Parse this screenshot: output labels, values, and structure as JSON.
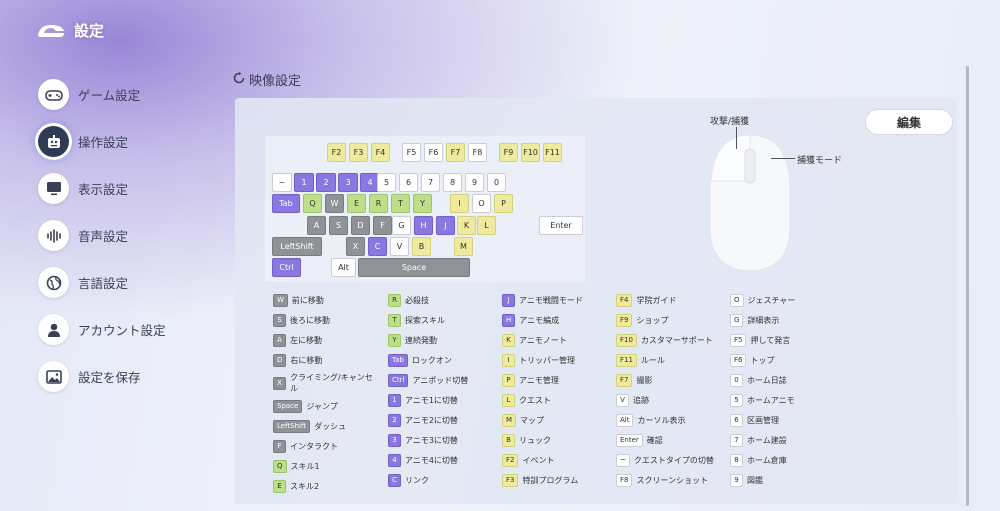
{
  "app": {
    "title": "設定"
  },
  "nav": [
    {
      "label": "ゲーム設定",
      "icon": "gamepad-icon"
    },
    {
      "label": "操作設定",
      "icon": "controller-icon",
      "active": true
    },
    {
      "label": "表示設定",
      "icon": "monitor-icon"
    },
    {
      "label": "音声設定",
      "icon": "audio-wave-icon"
    },
    {
      "label": "言語設定",
      "icon": "globe-icon"
    },
    {
      "label": "アカウント設定",
      "icon": "user-icon"
    },
    {
      "label": "設定を保存",
      "icon": "image-icon"
    }
  ],
  "section": {
    "title": "映像設定"
  },
  "edit_button": "編集",
  "mouse": {
    "left_label": "攻撃/捕獲",
    "middle_label": "捕獲モード"
  },
  "keys": [
    "F2",
    "F3",
    "F4",
    "F5",
    "F6",
    "F7",
    "F8",
    "F9",
    "F10",
    "F11",
    "~",
    "1",
    "2",
    "3",
    "4",
    "5",
    "6",
    "7",
    "8",
    "9",
    "0",
    "Tab",
    "Q",
    "W",
    "E",
    "R",
    "T",
    "Y",
    "I",
    "O",
    "P",
    "A",
    "S",
    "D",
    "F",
    "G",
    "H",
    "J",
    "K",
    "L",
    "Enter",
    "LeftShift",
    "X",
    "C",
    "V",
    "B",
    "M",
    "Ctrl",
    "Alt",
    "Space"
  ],
  "key_colors": {
    "white": "#ffffff",
    "yellow": "#eeeb9e",
    "green": "#bddf87",
    "purple": "#8a77df",
    "gray": "#8f9297"
  },
  "legend": [
    [
      {
        "k": "W",
        "t": "前に移動",
        "c": "gray"
      },
      {
        "k": "S",
        "t": "後ろに移動",
        "c": "gray"
      },
      {
        "k": "A",
        "t": "左に移動",
        "c": "gray"
      },
      {
        "k": "D",
        "t": "右に移動",
        "c": "gray"
      },
      {
        "k": "X",
        "t": "クライミング/キャンセル",
        "c": "gray",
        "tall": true
      },
      {
        "k": "Space",
        "t": "ジャンプ",
        "c": "gray"
      },
      {
        "k": "LeftShift",
        "t": "ダッシュ",
        "c": "gray"
      },
      {
        "k": "F",
        "t": "インタラクト",
        "c": "gray"
      },
      {
        "k": "Q",
        "t": "スキル1",
        "c": "green"
      },
      {
        "k": "E",
        "t": "スキル2",
        "c": "green"
      }
    ],
    [
      {
        "k": "R",
        "t": "必殺技",
        "c": "green"
      },
      {
        "k": "T",
        "t": "探索スキル",
        "c": "green"
      },
      {
        "k": "Y",
        "t": "連続発動",
        "c": "green"
      },
      {
        "k": "Tab",
        "t": "ロックオン",
        "c": "purple"
      },
      {
        "k": "Ctrl",
        "t": "アニポッド切替",
        "c": "purple"
      },
      {
        "k": "1",
        "t": "アニモ1に切替",
        "c": "purple"
      },
      {
        "k": "2",
        "t": "アニモ2に切替",
        "c": "purple"
      },
      {
        "k": "3",
        "t": "アニモ3に切替",
        "c": "purple"
      },
      {
        "k": "4",
        "t": "アニモ4に切替",
        "c": "purple"
      },
      {
        "k": "C",
        "t": "リンク",
        "c": "purple"
      }
    ],
    [
      {
        "k": "J",
        "t": "アニモ戦闘モード",
        "c": "purple"
      },
      {
        "k": "H",
        "t": "アニモ編成",
        "c": "purple"
      },
      {
        "k": "K",
        "t": "アニモノート",
        "c": "yellow"
      },
      {
        "k": "I",
        "t": "トリッパー管理",
        "c": "yellow"
      },
      {
        "k": "P",
        "t": "アニモ管理",
        "c": "yellow"
      },
      {
        "k": "L",
        "t": "クエスト",
        "c": "yellow"
      },
      {
        "k": "M",
        "t": "マップ",
        "c": "yellow"
      },
      {
        "k": "B",
        "t": "リュック",
        "c": "yellow"
      },
      {
        "k": "F2",
        "t": "イベント",
        "c": "yellow"
      },
      {
        "k": "F3",
        "t": "特訓プログラム",
        "c": "yellow"
      }
    ],
    [
      {
        "k": "F4",
        "t": "学院ガイド",
        "c": "yellow"
      },
      {
        "k": "F9",
        "t": "ショップ",
        "c": "yellow"
      },
      {
        "k": "F10",
        "t": "カスタマーサポート",
        "c": "yellow"
      },
      {
        "k": "F11",
        "t": "ルール",
        "c": "yellow"
      },
      {
        "k": "F7",
        "t": "撮影",
        "c": "yellow"
      },
      {
        "k": "V",
        "t": "追跡",
        "c": "white"
      },
      {
        "k": "Alt",
        "t": "カーソル表示",
        "c": "white"
      },
      {
        "k": "Enter",
        "t": "確認",
        "c": "white"
      },
      {
        "k": "~",
        "t": "クエストタイプの切替",
        "c": "white"
      },
      {
        "k": "F8",
        "t": "スクリーンショット",
        "c": "white"
      }
    ],
    [
      {
        "k": "O",
        "t": "ジェスチャー",
        "c": "white"
      },
      {
        "k": "G",
        "t": "詳細表示",
        "c": "white"
      },
      {
        "k": "F5",
        "t": "押して発言",
        "c": "white"
      },
      {
        "k": "F6",
        "t": "トップ",
        "c": "white"
      },
      {
        "k": "0",
        "t": "ホーム日誌",
        "c": "white"
      },
      {
        "k": "5",
        "t": "ホームアニモ",
        "c": "white"
      },
      {
        "k": "6",
        "t": "区画管理",
        "c": "white"
      },
      {
        "k": "7",
        "t": "ホーム建設",
        "c": "white"
      },
      {
        "k": "8",
        "t": "ホーム倉庫",
        "c": "white"
      },
      {
        "k": "9",
        "t": "図鑑",
        "c": "white"
      }
    ]
  ]
}
